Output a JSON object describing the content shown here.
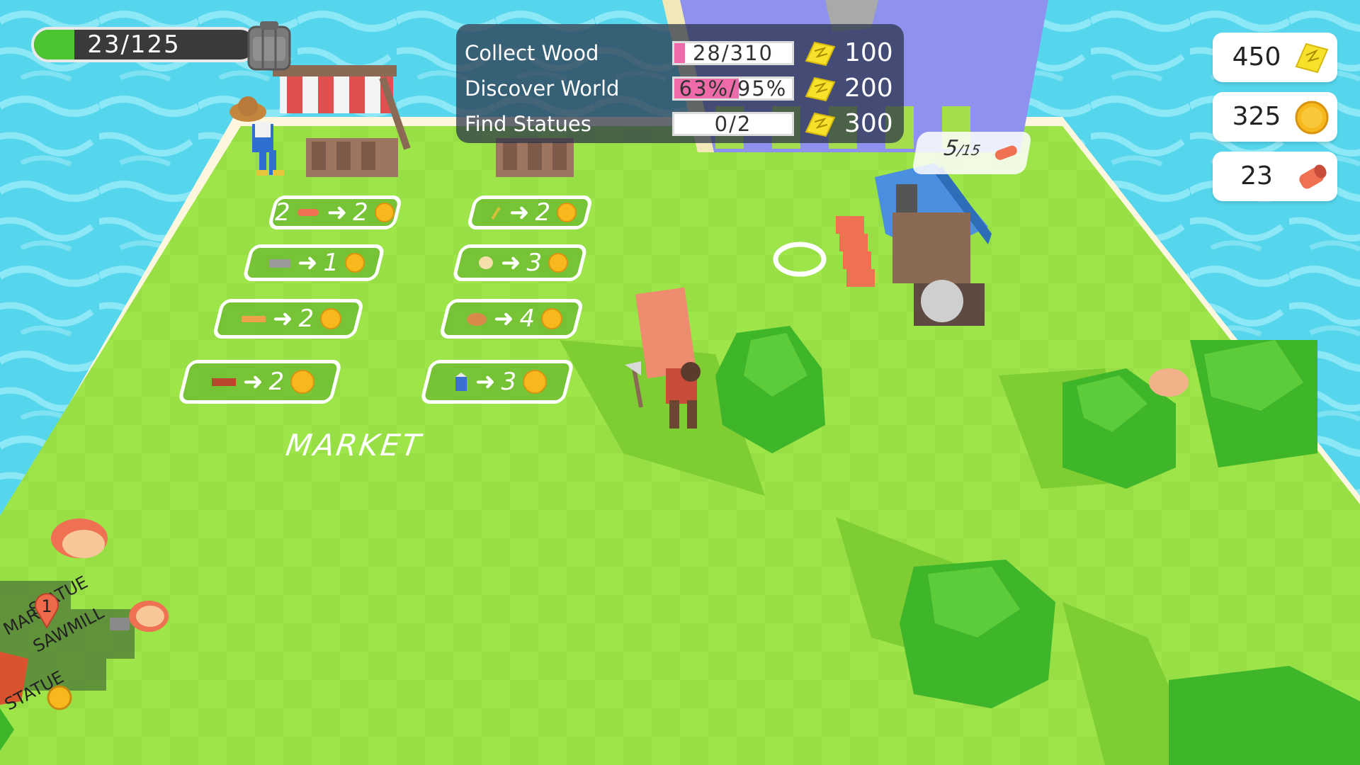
{
  "backpack": {
    "count_text": "23/125",
    "fill": 0.184
  },
  "quests": [
    {
      "name": "Collect Wood",
      "progress": "28/310",
      "fill": 0.09,
      "reward": "100"
    },
    {
      "name": "Discover World",
      "progress": "63%/95%",
      "fill": 0.55,
      "reward": "200"
    },
    {
      "name": "Find Statues",
      "progress": "0/2",
      "fill": 0.0,
      "reward": "300"
    }
  ],
  "currencies": {
    "tickets": "450",
    "coins": "325",
    "logs": "23"
  },
  "market": {
    "label": "MARKET",
    "trades_left": [
      {
        "qty": "2",
        "item": "log",
        "price": "2"
      },
      {
        "qty": "",
        "item": "stone",
        "price": "1"
      },
      {
        "qty": "",
        "item": "plank",
        "price": "2"
      },
      {
        "qty": "",
        "item": "brick",
        "price": "2"
      }
    ],
    "trades_right": [
      {
        "qty": "",
        "item": "wheat",
        "price": "2"
      },
      {
        "qty": "",
        "item": "egg",
        "price": "3"
      },
      {
        "qty": "",
        "item": "bread",
        "price": "4"
      },
      {
        "qty": "",
        "item": "milk",
        "price": "3"
      }
    ]
  },
  "sawmill": {
    "count": "5",
    "capacity": "/15"
  },
  "minimap": {
    "labels": [
      "STATUE",
      "SAWMILL",
      "STATUE"
    ],
    "truncated_label": "MAR",
    "pin_number": "1"
  },
  "colors": {
    "water": "#56d6ec",
    "grass": "#9fe34a",
    "path": "#8e91ee",
    "ticket": "#f7e12a",
    "coin": "#f6b81c",
    "log": "#ee7151"
  }
}
